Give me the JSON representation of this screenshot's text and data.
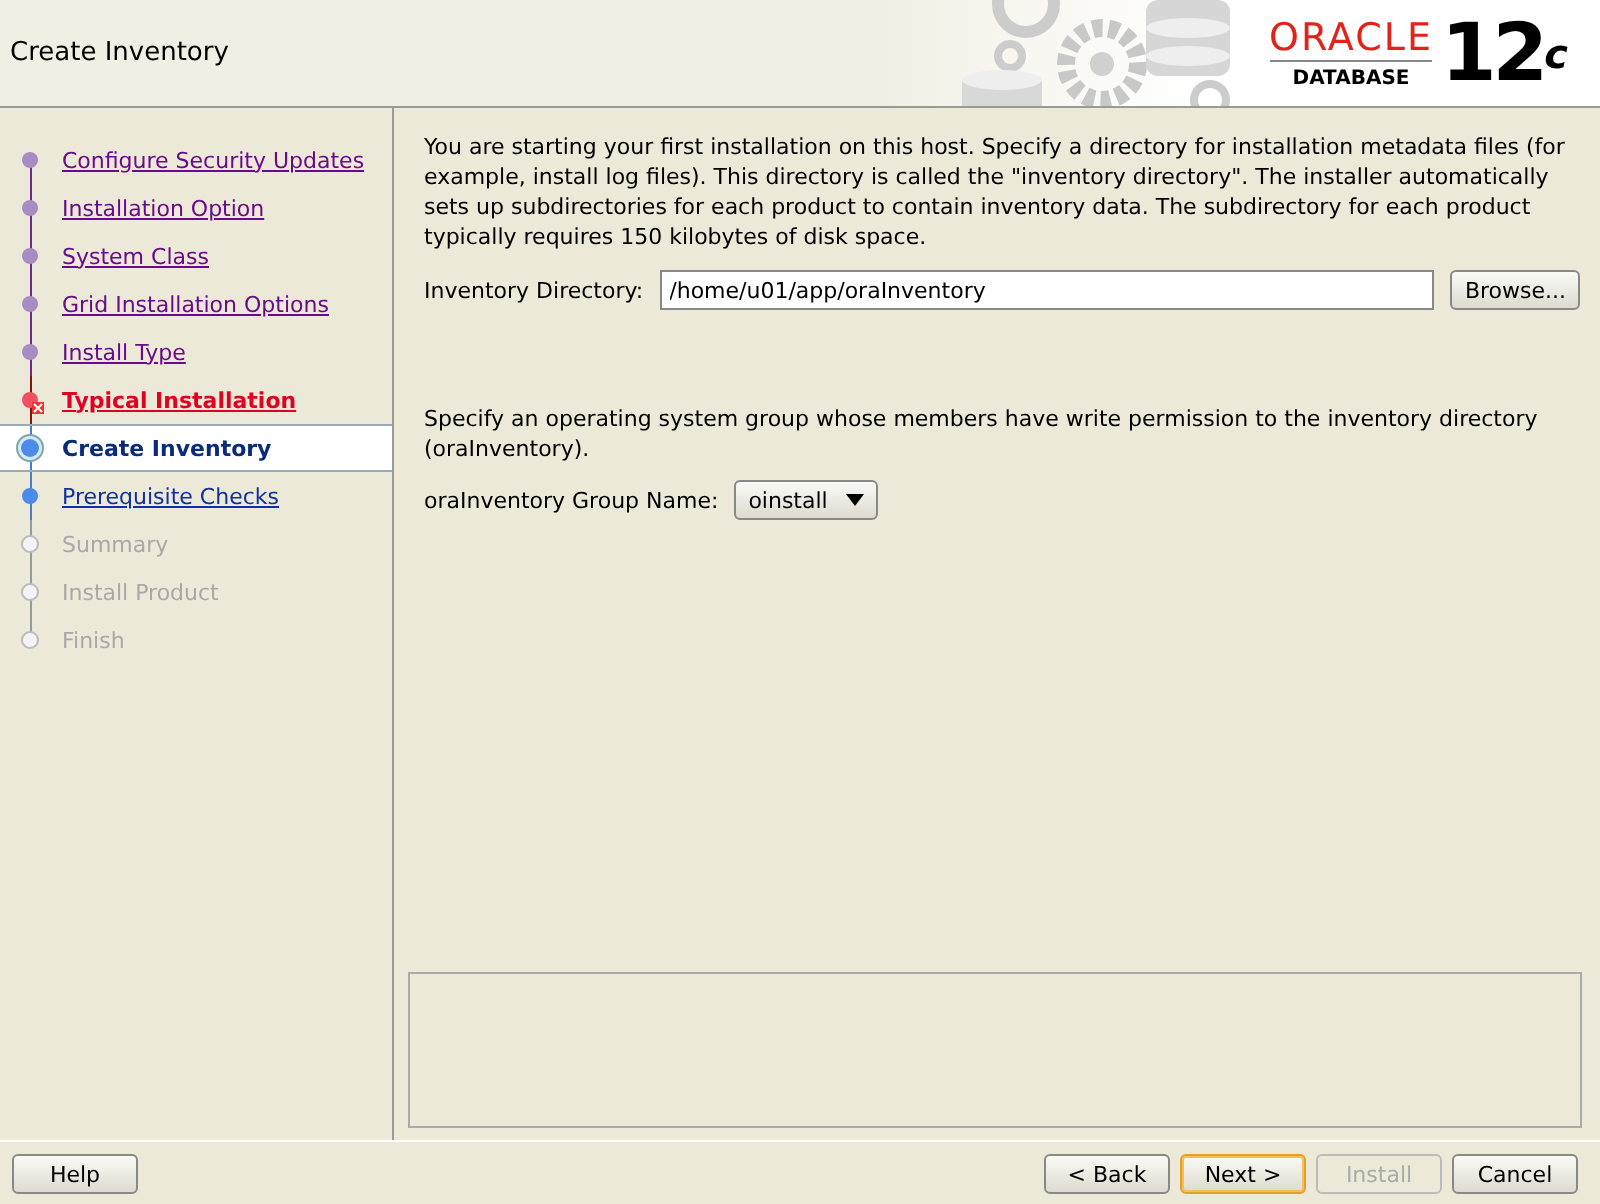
{
  "window": {
    "title": "Create Inventory"
  },
  "logo": {
    "brand": "ORACLE",
    "product": "DATABASE",
    "version": "12",
    "version_sup": "c"
  },
  "steps": [
    {
      "label": "Configure Security Updates",
      "visited": true,
      "error": false,
      "disabled": false,
      "selected": false
    },
    {
      "label": "Installation Option",
      "visited": true,
      "error": false,
      "disabled": false,
      "selected": false
    },
    {
      "label": "System Class",
      "visited": true,
      "error": false,
      "disabled": false,
      "selected": false
    },
    {
      "label": "Grid Installation Options",
      "visited": true,
      "error": false,
      "disabled": false,
      "selected": false
    },
    {
      "label": "Install Type",
      "visited": true,
      "error": false,
      "disabled": false,
      "selected": false
    },
    {
      "label": "Typical Installation",
      "visited": true,
      "error": true,
      "disabled": false,
      "selected": false
    },
    {
      "label": "Create Inventory",
      "visited": false,
      "error": false,
      "disabled": false,
      "selected": true
    },
    {
      "label": "Prerequisite Checks",
      "visited": false,
      "error": false,
      "disabled": false,
      "selected": false
    },
    {
      "label": "Summary",
      "visited": false,
      "error": false,
      "disabled": true,
      "selected": false
    },
    {
      "label": "Install Product",
      "visited": false,
      "error": false,
      "disabled": true,
      "selected": false
    },
    {
      "label": "Finish",
      "visited": false,
      "error": false,
      "disabled": true,
      "selected": false
    }
  ],
  "content": {
    "intro": "You are starting your first installation on this host. Specify a directory for installation metadata files (for example, install log files). This directory is called the \"inventory directory\". The installer automatically sets up subdirectories for each product to contain inventory data. The subdirectory for each product typically requires 150 kilobytes of disk space.",
    "directory_label": "Inventory Directory:",
    "directory_value": "/home/u01/app/oraInventory",
    "browse_button": "Browse...",
    "group_text": "Specify an operating system group whose members have write permission to the inventory directory (oraInventory).",
    "group_label": "oraInventory Group Name:",
    "group_value": "oinstall"
  },
  "buttons": [
    {
      "label": "Help",
      "kind": "left",
      "disabled": false,
      "focused": false
    },
    {
      "label": "< Back",
      "kind": "right",
      "disabled": false,
      "focused": false
    },
    {
      "label": "Next >",
      "kind": "right",
      "disabled": false,
      "focused": true
    },
    {
      "label": "Install",
      "kind": "right",
      "disabled": true,
      "focused": false
    },
    {
      "label": "Cancel",
      "kind": "right",
      "disabled": false,
      "focused": false
    }
  ]
}
